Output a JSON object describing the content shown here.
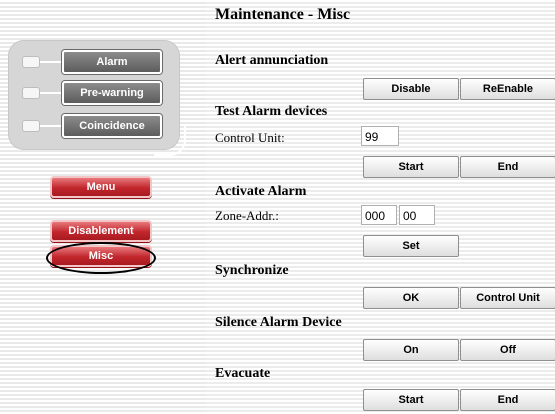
{
  "page": {
    "title": "Maintenance - Misc"
  },
  "indicators": [
    {
      "label": "Alarm"
    },
    {
      "label": "Pre-warning"
    },
    {
      "label": "Coincidence"
    }
  ],
  "nav": {
    "menu": "Menu",
    "disablement": "Disablement",
    "misc": "Misc"
  },
  "sections": {
    "alert": {
      "title": "Alert annunciation",
      "disable": "Disable",
      "reenable": "ReEnable"
    },
    "test": {
      "title": "Test Alarm devices",
      "label": "Control Unit:",
      "value": "99",
      "start": "Start",
      "end": "End"
    },
    "activate": {
      "title": "Activate Alarm",
      "label": "Zone-Addr.:",
      "zone": "000",
      "addr": "00",
      "set": "Set"
    },
    "sync": {
      "title": "Synchronize",
      "ok": "OK",
      "control_unit": "Control Unit"
    },
    "silence": {
      "title": "Silence Alarm Device",
      "on": "On",
      "off": "Off"
    },
    "evacuate": {
      "title": "Evacuate",
      "start": "Start",
      "end": "End"
    }
  },
  "colors": {
    "accent_red": "#c1272d",
    "indicator_gray": "#6e6e6e"
  }
}
